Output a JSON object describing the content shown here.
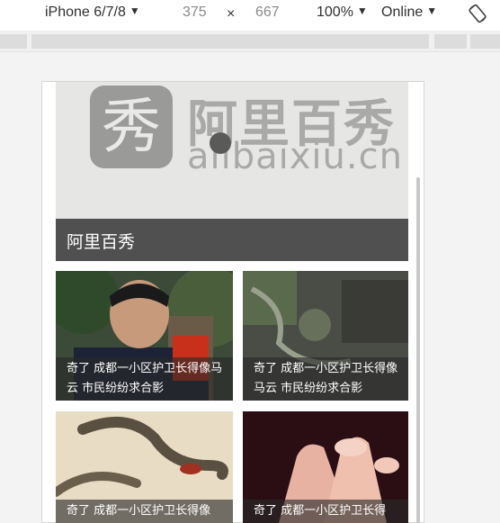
{
  "toolbar": {
    "device": "iPhone 6/7/8",
    "width": "375",
    "times": "×",
    "height": "667",
    "zoom": "100%",
    "network": "Online",
    "caret": "▼",
    "rotate_icon": "rotate-icon"
  },
  "banner": {
    "logo_glyph": "秀",
    "logo_cn": "阿里百秀",
    "logo_en": "alibaixiu.cn",
    "title": "阿里百秀"
  },
  "cards": [
    {
      "caption": "奇了 成都一小区护卫长得像马云 市民纷纷求合影"
    },
    {
      "caption": "奇了 成都一小区护卫长得像马云 市民纷纷求合影"
    },
    {
      "caption": "奇了 成都一小区护卫长得像"
    },
    {
      "caption": "奇了 成都一小区护卫长得"
    }
  ]
}
